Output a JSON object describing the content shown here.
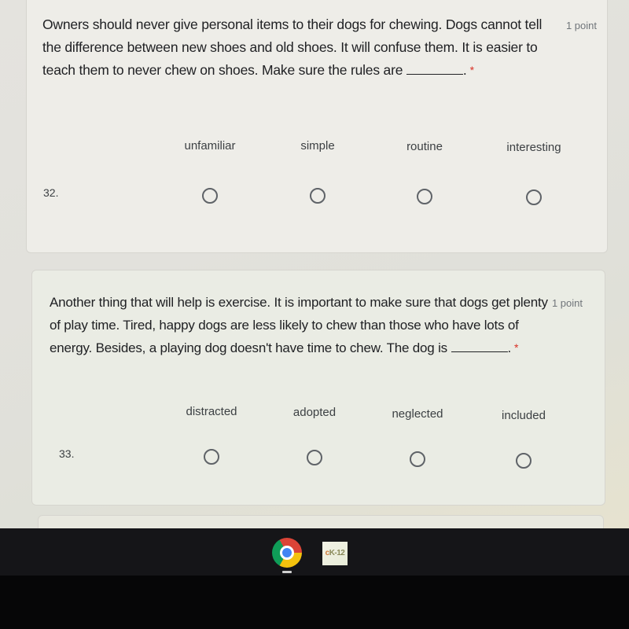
{
  "questions": [
    {
      "text": "Owners should never give personal items to their dogs for chewing. Dogs cannot tell the difference between new shoes and old shoes. It will confuse them. It is easier to teach them to never chew on shoes. Make sure the rules are",
      "after_blank": ".",
      "required_marker": "*",
      "points": "1 point",
      "row_number": "32.",
      "options": [
        "unfamiliar",
        "simple",
        "routine",
        "interesting"
      ],
      "selected": null
    },
    {
      "text": "Another thing that will help is exercise. It is important to make sure that dogs get plenty of play time. Tired, happy dogs are less likely to chew than those who have lots of energy. Besides, a playing dog doesn't have time to chew. The dog is",
      "after_blank": ".",
      "required_marker": "*",
      "points": "1 point",
      "row_number": "33.",
      "options": [
        "distracted",
        "adopted",
        "neglected",
        "included"
      ],
      "selected": null
    }
  ],
  "taskbar": {
    "apps": [
      {
        "name": "Google Chrome",
        "icon": "chrome-icon",
        "active": true
      },
      {
        "name": "CK-12",
        "icon": "ck12-icon",
        "label_c": "c",
        "label_rest": "K-12"
      }
    ]
  }
}
